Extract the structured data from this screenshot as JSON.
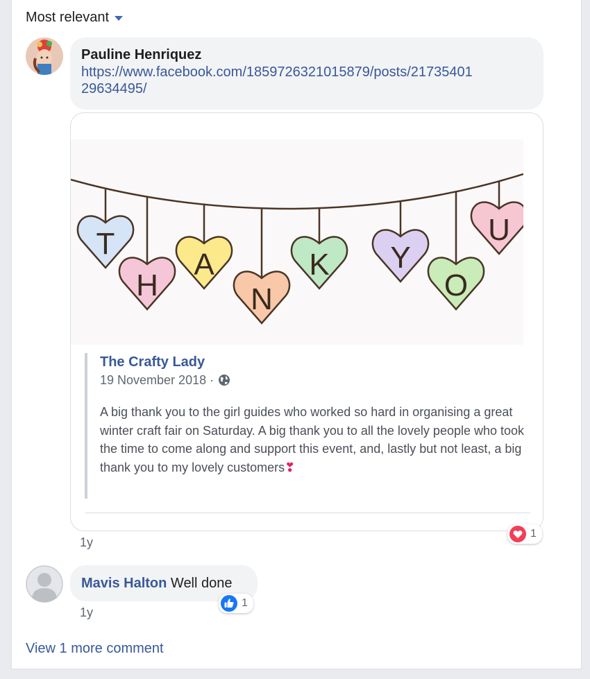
{
  "sort": {
    "label": "Most relevant"
  },
  "comments": [
    {
      "author": "Pauline Henriquez",
      "link_line1": "https://www.facebook.com/1859726321015879/posts/21735401",
      "link_line2": "29634495/",
      "shared_post": {
        "image_letters": [
          "T",
          "H",
          "A",
          "N",
          "K",
          "Y",
          "O",
          "U"
        ],
        "page_name": "The Crafty Lady",
        "date": "19 November 2018 · ",
        "privacy_icon": "globe-icon",
        "text": "A big thank you to the girl guides who worked so hard in organising a great winter craft fair on Saturday. A big thank you to all the lovely people who took the time to come along and support this event, and, lastly but not least, a big thank you to my lovely customers",
        "emoji": "❣"
      },
      "time": "1y",
      "reaction": {
        "icon": "love-icon",
        "count": "1",
        "color": "#f33e58"
      }
    },
    {
      "author": "Mavis Halton",
      "text": "Well done",
      "time": "1y",
      "reaction": {
        "icon": "like-icon",
        "count": "1",
        "color": "#1877f2"
      }
    }
  ],
  "view_more": "View 1 more comment"
}
